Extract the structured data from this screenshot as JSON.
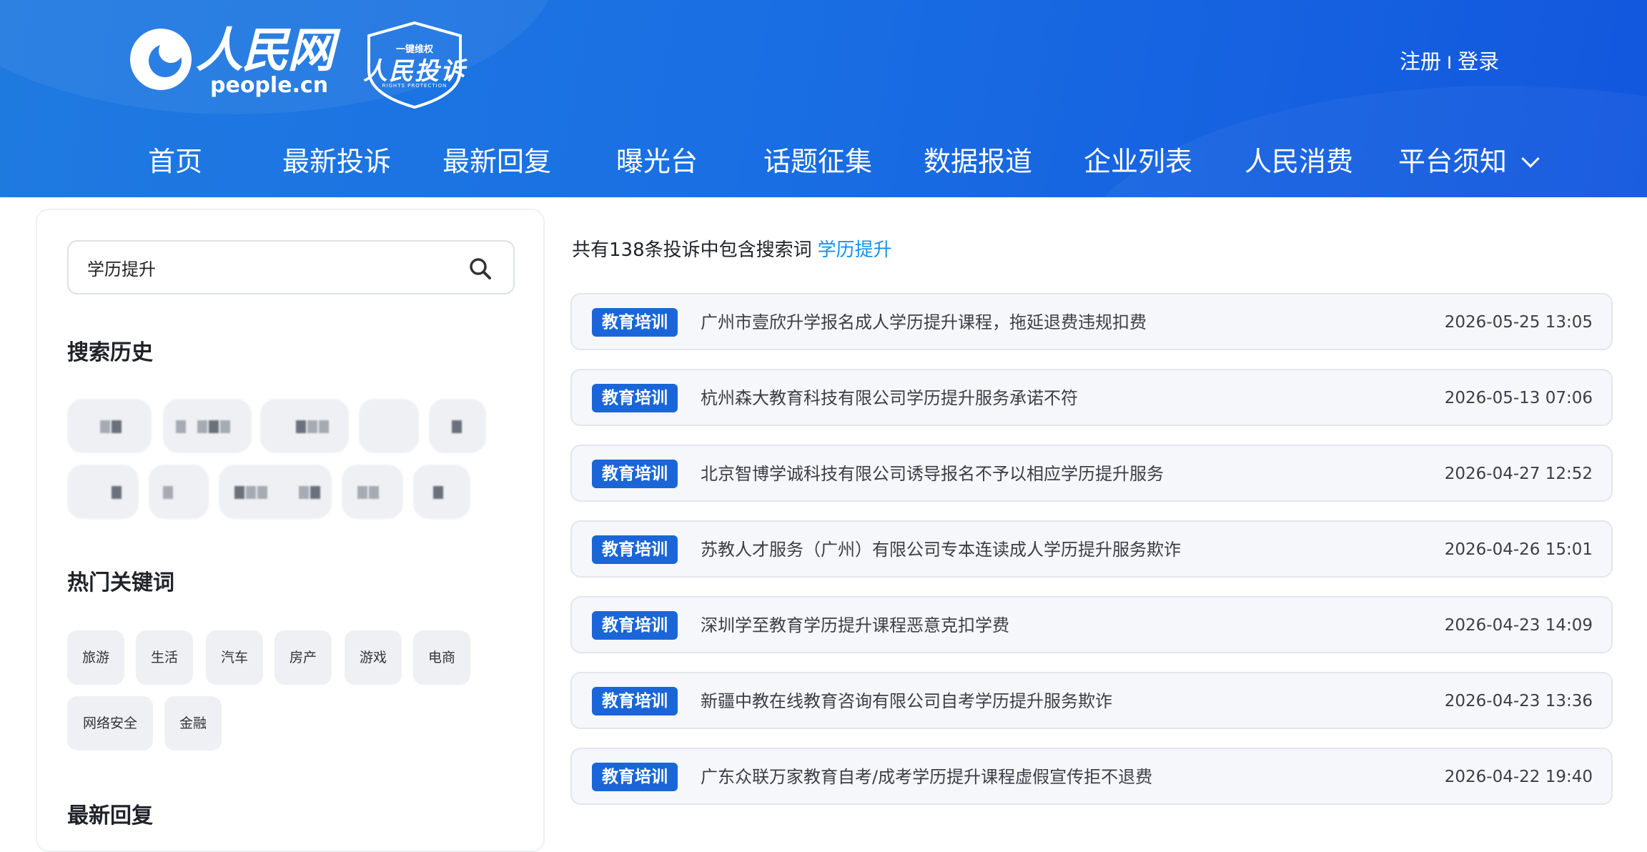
{
  "header": {
    "logo_cn": "人民网",
    "logo_en": "people.cn",
    "badge_top": "一键维权",
    "badge_main": "人民投诉",
    "badge_sub": "RIGHTS PROTECTION",
    "register": "注册",
    "separator": "I",
    "login": "登录"
  },
  "nav": [
    {
      "label": "首页"
    },
    {
      "label": "最新投诉"
    },
    {
      "label": "最新回复"
    },
    {
      "label": "曝光台"
    },
    {
      "label": "话题征集"
    },
    {
      "label": "数据报道"
    },
    {
      "label": "企业列表"
    },
    {
      "label": "人民消费"
    },
    {
      "label": "平台须知",
      "icon": "chevron-down-icon"
    }
  ],
  "sidebar": {
    "search_value": "学历提升",
    "search_icon": "search-icon",
    "history_title": "搜索历史",
    "hot_title": "热门关键词",
    "hot_keywords": [
      "旅游",
      "生活",
      "汽车",
      "房产",
      "游戏",
      "电商",
      "网络安全",
      "金融"
    ],
    "latest_title": "最新回复"
  },
  "results": {
    "summary_prefix": "共有138条投诉中包含搜索词",
    "summary_term": "学历提升",
    "items": [
      {
        "tag": "教育培训",
        "title": "广州市壹欣升学报名成人学历提升课程，拖延退费违规扣费",
        "date": "2026-05-25 13:05"
      },
      {
        "tag": "教育培训",
        "title": "杭州森大教育科技有限公司学历提升服务承诺不符",
        "date": "2026-05-13 07:06"
      },
      {
        "tag": "教育培训",
        "title": "北京智博学诚科技有限公司诱导报名不予以相应学历提升服务",
        "date": "2026-04-27 12:52"
      },
      {
        "tag": "教育培训",
        "title": "苏教人才服务（广州）有限公司专本连读成人学历提升服务欺诈",
        "date": "2026-04-26 15:01"
      },
      {
        "tag": "教育培训",
        "title": "深圳学至教育学历提升课程恶意克扣学费",
        "date": "2026-04-23 14:09"
      },
      {
        "tag": "教育培训",
        "title": "新疆中教在线教育咨询有限公司自考学历提升服务欺诈",
        "date": "2026-04-23 13:36"
      },
      {
        "tag": "教育培训",
        "title": "广东众联万家教育自考/成考学历提升课程虚假宣传拒不退费",
        "date": "2026-04-22 19:40"
      }
    ]
  },
  "colors": {
    "header_blue": "#1a6fe3",
    "tag_blue": "#1a66d8",
    "link_blue": "#1890e8"
  }
}
